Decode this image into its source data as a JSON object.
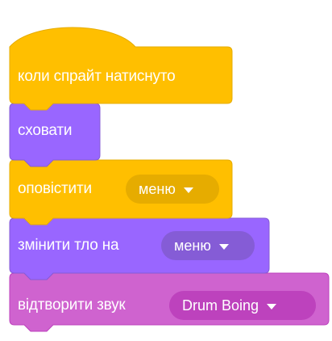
{
  "script": {
    "blocks": [
      {
        "kind": "hat",
        "category": "events",
        "label": "коли спрайт натиснуто"
      },
      {
        "kind": "stack",
        "category": "looks",
        "label": "сховати"
      },
      {
        "kind": "stack",
        "category": "events",
        "label": "оповістити",
        "dropdown": "меню"
      },
      {
        "kind": "stack",
        "category": "looks",
        "label": "змінити тло на",
        "dropdown": "меню"
      },
      {
        "kind": "stack",
        "category": "sound",
        "label": "відтворити звук",
        "dropdown": "Drum Boing"
      }
    ]
  },
  "colors": {
    "events": "#FFBF00",
    "events_dark": "#E6AC00",
    "looks": "#9966FF",
    "looks_dark": "#855CD6",
    "sound": "#CF63CF",
    "sound_dark": "#BD42BD"
  },
  "icons": {
    "dropdown": "caret-down-icon"
  }
}
